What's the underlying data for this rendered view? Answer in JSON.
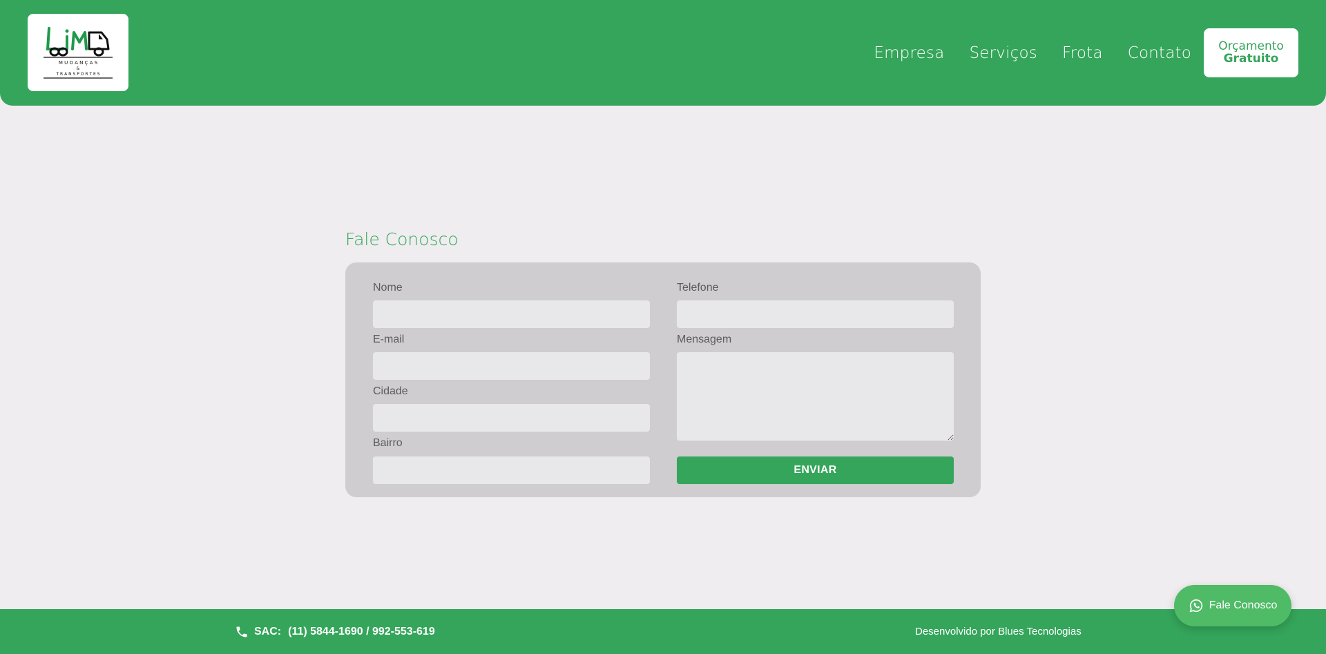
{
  "colors": {
    "brand": "#34a55a",
    "background": "#efedef",
    "card": "#cfcdcf",
    "input": "#e8e7e9",
    "whatsapp": "#4fbb67"
  },
  "header": {
    "logo": {
      "text": "LIM",
      "line1": "M U D A N Ç A S",
      "line2": "&",
      "line3": "T R A N S P O R T E S"
    },
    "nav": [
      "Empresa",
      "Serviços",
      "Frota",
      "Contato"
    ],
    "cta": {
      "line1": "Orçamento",
      "line2": "Gratuito"
    }
  },
  "contact": {
    "title": "Fale Conosco",
    "fields": {
      "nome": {
        "label": "Nome",
        "value": ""
      },
      "telefone": {
        "label": "Telefone",
        "value": ""
      },
      "email": {
        "label": "E-mail",
        "value": ""
      },
      "mensagem": {
        "label": "Mensagem",
        "value": ""
      },
      "cidade": {
        "label": "Cidade",
        "value": ""
      },
      "bairro": {
        "label": "Bairro",
        "value": ""
      }
    },
    "submit": "ENVIAR"
  },
  "footer": {
    "sac_label": "SAC:",
    "sac_phones": "(11) 5844-1690 / 992-553-619",
    "developer": "Desenvolvido por Blues Tecnologias"
  },
  "whatsapp_button": {
    "label": "Fale Conosco",
    "icon": "whatsapp-icon"
  }
}
